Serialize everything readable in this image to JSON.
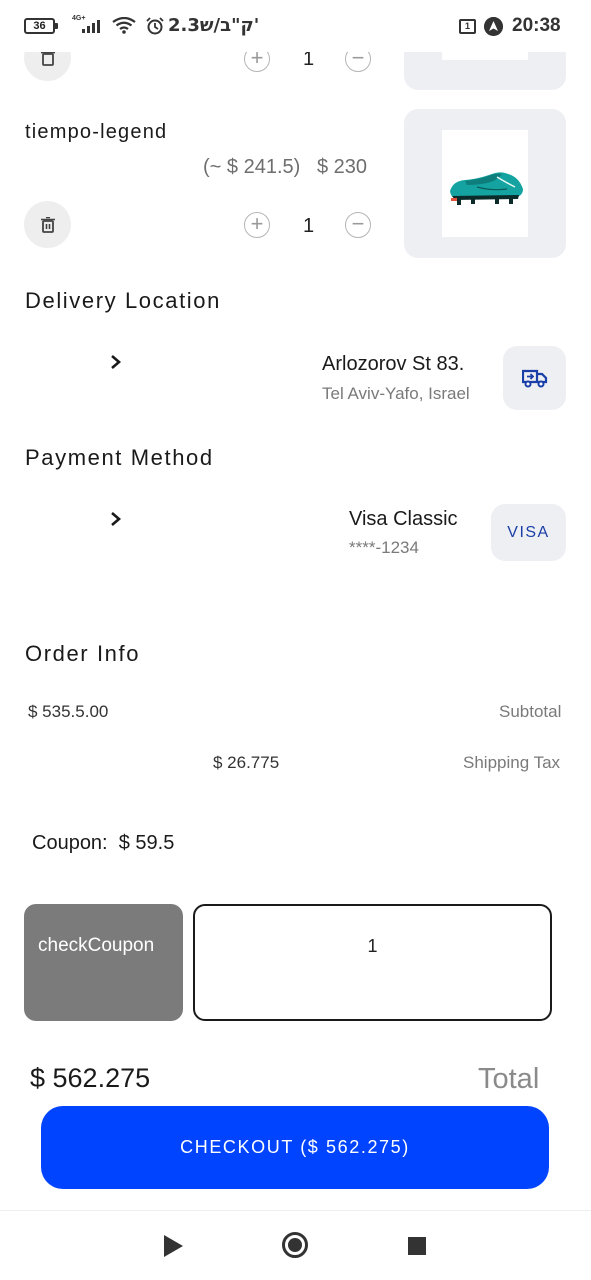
{
  "status_bar": {
    "battery": "36",
    "network": "4G+",
    "carrier_text": "2.3ק\"ב/ש'",
    "calendar_badge": "1",
    "time": "20:38"
  },
  "cart": {
    "prev_item": {
      "quantity": "1"
    },
    "item": {
      "name": "tiempo-legend",
      "original_price": "(~ $ 241.5)",
      "price": "$ 230",
      "quantity": "1"
    }
  },
  "delivery": {
    "title": "Delivery Location",
    "address_line1": "Arlozorov St 83.",
    "address_line2": "Tel Aviv-Yafo, Israel"
  },
  "payment": {
    "title": "Payment Method",
    "card_name": "Visa Classic",
    "card_number": "****-1234",
    "card_brand": "VISA"
  },
  "order_info": {
    "title": "Order Info",
    "subtotal_value": "$ 535.5.00",
    "subtotal_label": "Subtotal",
    "shipping_value": "$ 26.775",
    "shipping_label": "Shipping Tax"
  },
  "coupon": {
    "text": "Coupon:  $ 59.5",
    "button_label": "checkCoupon",
    "input_value": "1"
  },
  "total": {
    "amount": "$ 562.275",
    "label": "Total"
  },
  "checkout": {
    "label": "CHECKOUT ($ 562.275)"
  },
  "colors": {
    "accent": "#0044ff",
    "tile": "#eeeff2",
    "coupon_button": "#7b7b7b"
  }
}
